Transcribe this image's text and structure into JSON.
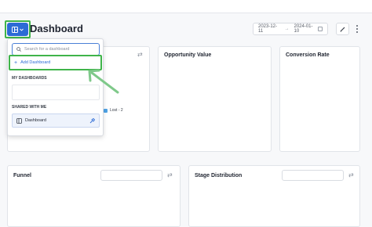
{
  "header": {
    "title": "Dashboard",
    "date_start": "2023-12-11",
    "date_separator": "→",
    "date_end": "2024-01-10"
  },
  "panels": {
    "opportunity_value": "Opportunity Value",
    "conversion_rate": "Conversion Rate",
    "funnel": "Funnel",
    "stage_distribution": "Stage Distribution"
  },
  "legend": {
    "lost_label": "Lost - 2"
  },
  "dropdown": {
    "search_placeholder": "Search for a dashboard",
    "add_label": "Add Dashboard",
    "my_dashboards_label": "MY DASHBOARDS",
    "shared_label": "SHARED WITH ME",
    "shared_items": [
      "Dashboard"
    ]
  },
  "colors": {
    "accent": "#2c6bd6",
    "highlight": "#3fb44a",
    "legend_lost": "#4fa3e6"
  }
}
